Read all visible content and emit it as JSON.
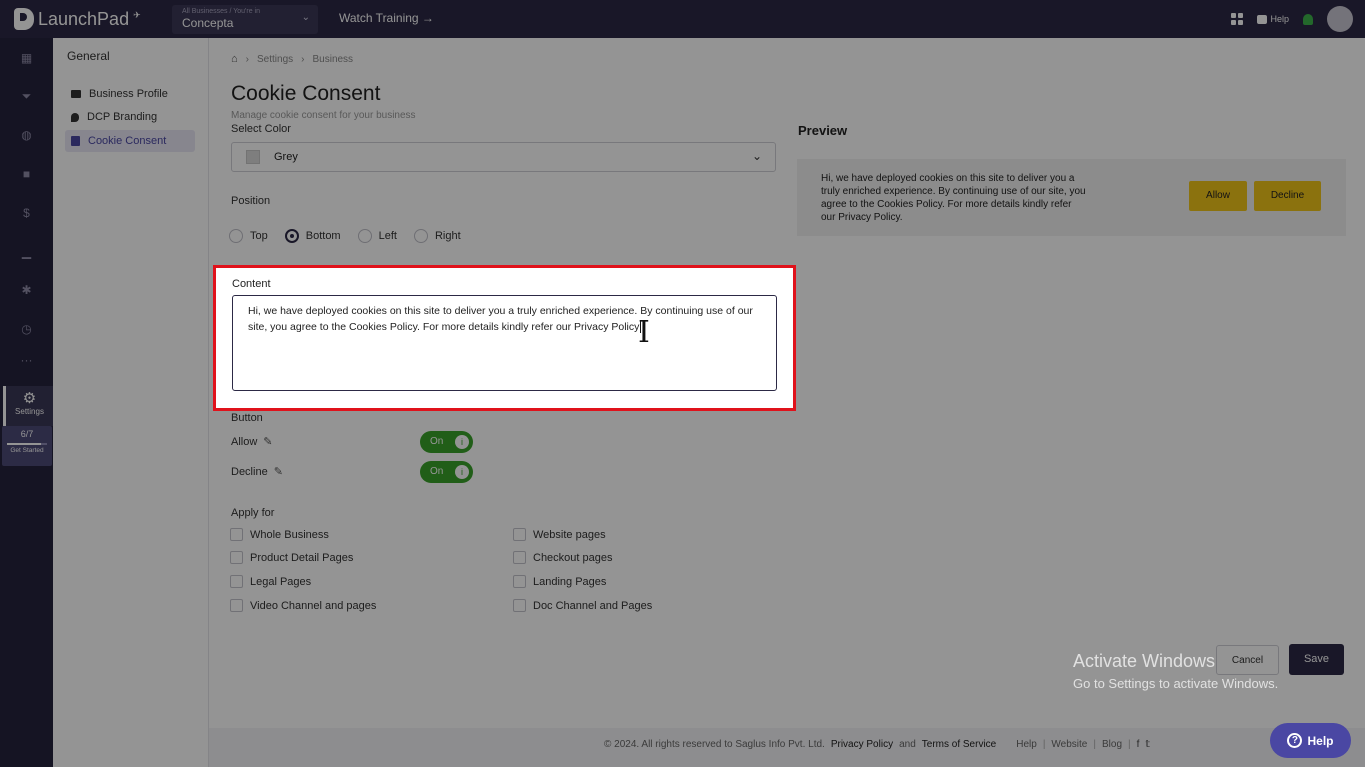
{
  "topbar": {
    "brand": "LaunchPad",
    "business_small": "All Businesses / You're in",
    "business_name": "Concepta",
    "watch_training": "Watch Training →",
    "help": "Help"
  },
  "rail": {
    "settings_label": "Settings",
    "progress_count": "6/7",
    "progress_fraction": 0.86,
    "get_started": "Get Started"
  },
  "subnav": {
    "title": "General",
    "items": [
      {
        "label": "Business Profile",
        "icon": "briefcase-icon"
      },
      {
        "label": "DCP Branding",
        "icon": "flag-icon"
      },
      {
        "label": "Cookie Consent",
        "icon": "cookie-icon"
      }
    ]
  },
  "breadcrumb": {
    "items": [
      "Settings",
      "Business"
    ]
  },
  "page": {
    "title": "Cookie Consent",
    "subtitle": "Manage cookie consent for your business"
  },
  "form": {
    "select_color_label": "Select Color",
    "color_value": "Grey",
    "position_label": "Position",
    "positions": [
      "Top",
      "Bottom",
      "Left",
      "Right"
    ],
    "selected_position": "Bottom",
    "content_label": "Content",
    "content_line1": "Hi, we have deployed cookies on this site to deliver you a truly enriched experience. By continuing use of our",
    "content_line2": "site, you agree to the Cookies Policy. For more details kindly refer our Privacy Policy",
    "button_label": "Button",
    "allow_label": "Allow",
    "decline_label": "Decline",
    "toggle_on": "On",
    "apply_label": "Apply for",
    "apply_left": [
      "Whole Business",
      "Product Detail Pages",
      "Legal Pages",
      "Video Channel and pages"
    ],
    "apply_right": [
      "Website pages",
      "Checkout pages",
      "Landing Pages",
      "Doc Channel and Pages"
    ],
    "cancel": "Cancel",
    "save": "Save"
  },
  "preview": {
    "title": "Preview",
    "line1": "Hi, we have deployed cookies on this site to deliver you a",
    "line2": "truly enriched experience. By continuing use of our site, you",
    "line3": "agree to the Cookies Policy. For more details kindly refer",
    "line4": "our Privacy Policy.",
    "allow": "Allow",
    "decline": "Decline"
  },
  "footer": {
    "copyright": "© 2024. All rights reserved to Saglus Info Pvt. Ltd.",
    "privacy": "Privacy Policy",
    "and": "and",
    "terms": "Terms of Service",
    "help": "Help",
    "website": "Website",
    "blog": "Blog"
  },
  "help_button": "Help",
  "watermark": {
    "line1": "Activate Windows",
    "line2": "Go to Settings to activate Windows."
  },
  "colors": {
    "topbar": "#2c2945",
    "accent": "#4a47a3",
    "toggle_on": "#3aa32a",
    "preview_buttons": "#f0c419",
    "highlight": "#e0121b"
  }
}
